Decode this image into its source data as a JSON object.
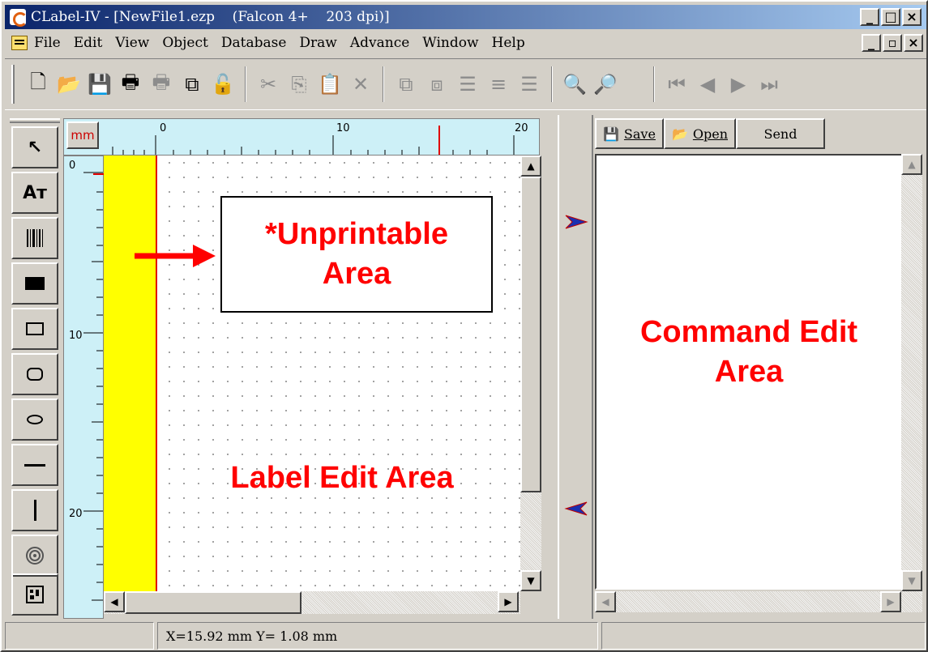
{
  "window": {
    "title": "CLabel-IV - [NewFile1.ezp    (Falcon 4+    203 dpi)]",
    "caption_buttons": [
      "_",
      "□",
      "×"
    ],
    "mdi_buttons": [
      "_",
      "▫",
      "×"
    ]
  },
  "menu": {
    "items": [
      "File",
      "Edit",
      "View",
      "Object",
      "Database",
      "Draw",
      "Advance",
      "Window",
      "Help"
    ]
  },
  "toolbar": {
    "icons": [
      "new-icon",
      "open-icon",
      "save-icon",
      "print-icon",
      "print-preview-icon",
      "copy-page-icon",
      "unlock-icon",
      "cut-icon",
      "copy-icon",
      "paste-icon",
      "delete-icon",
      "group-icon",
      "ungroup-icon",
      "align-left-icon",
      "align-center-icon",
      "align-right-icon",
      "zoom-out-icon",
      "zoom-in-icon",
      "first-page-icon",
      "prev-page-icon",
      "next-page-icon",
      "last-page-icon"
    ]
  },
  "ruler": {
    "unit": "mm",
    "top_labels": [
      "0",
      "10",
      "20"
    ],
    "left_labels": [
      "0",
      "10",
      "20"
    ]
  },
  "tools": [
    "pointer-tool",
    "text-tool",
    "barcode-tool",
    "filled-rectangle-tool",
    "rectangle-tool",
    "rounded-rectangle-tool",
    "ellipse-tool",
    "horizontal-line-tool",
    "vertical-line-tool",
    "image-tool",
    "2d-barcode-tool"
  ],
  "annotations": {
    "unprintable": "*Unprintable Area",
    "label_edit": "Label Edit Area",
    "command_edit": "Command Edit Area"
  },
  "command_toolbar": {
    "save": "Save",
    "open": "Open",
    "send": "Send"
  },
  "status": {
    "left": "",
    "coords": "X=15.92 mm  Y= 1.08 mm",
    "right": ""
  }
}
